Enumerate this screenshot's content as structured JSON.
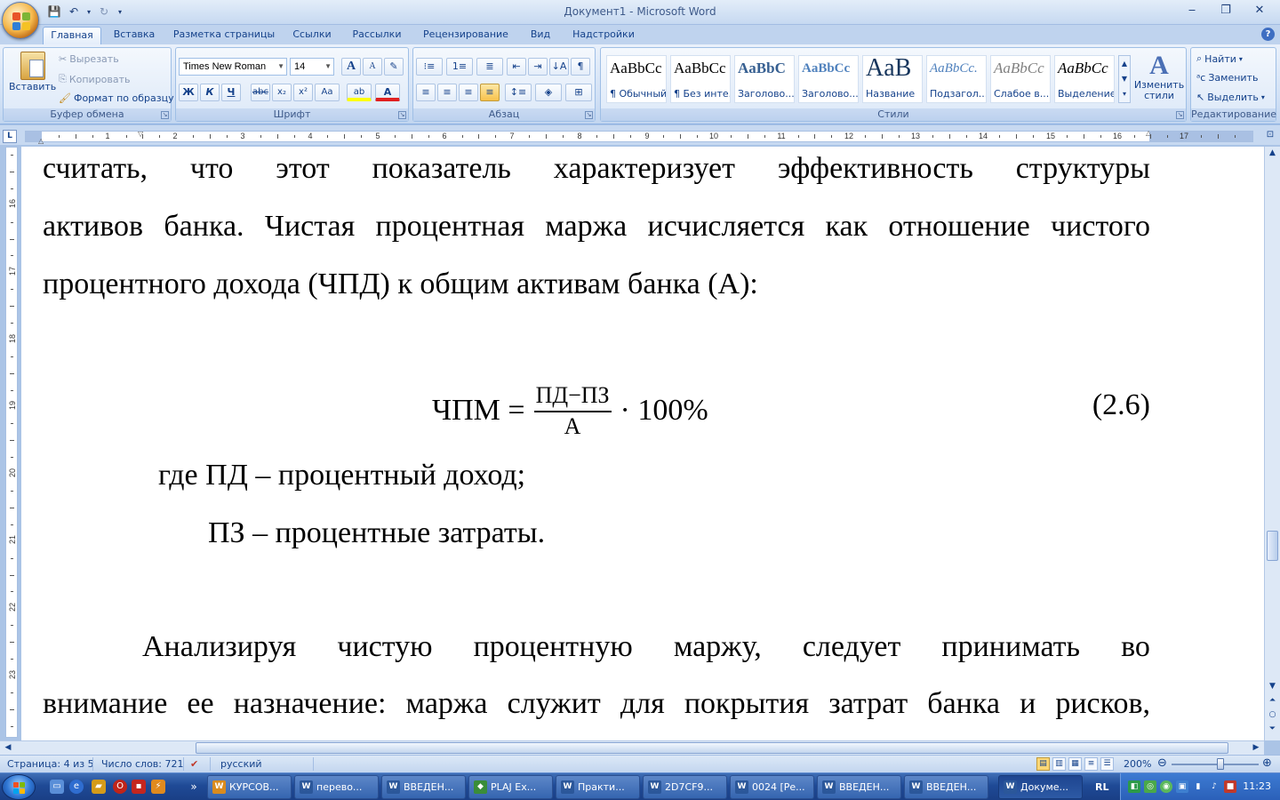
{
  "window": {
    "title": "Документ1 - Microsoft Word",
    "min": "‒",
    "restore": "❐",
    "close": "✕"
  },
  "qat": [
    "💾",
    "↶",
    "▾",
    "↻",
    "▾"
  ],
  "tabs": [
    "Главная",
    "Вставка",
    "Разметка страницы",
    "Ссылки",
    "Рассылки",
    "Рецензирование",
    "Вид",
    "Надстройки"
  ],
  "ribbon": {
    "clipboard": {
      "label": "Буфер обмена",
      "paste": "Вставить",
      "cut": "Вырезать",
      "copy": "Копировать",
      "format_painter": "Формат по образцу"
    },
    "font": {
      "label": "Шрифт",
      "name": "Times New Roman",
      "size": "14",
      "grow": "A",
      "shrink": "A",
      "clear": "✎",
      "bold": "Ж",
      "italic": "К",
      "underline": "Ч",
      "strike": "abc",
      "subscript": "x₂",
      "superscript": "x²",
      "case": "Aa",
      "highlight": "ab",
      "color": "A"
    },
    "paragraph": {
      "label": "Абзац"
    },
    "styles": {
      "label": "Стили",
      "items": [
        {
          "sample": "AaBbCc",
          "name": "¶ Обычный"
        },
        {
          "sample": "AaBbCc",
          "name": "¶ Без инте..."
        },
        {
          "sample": "AaBbC",
          "name": "Заголово..."
        },
        {
          "sample": "AaBbCc",
          "name": "Заголово..."
        },
        {
          "sample": "AaB",
          "name": "Название"
        },
        {
          "sample": "AaBbCc.",
          "name": "Подзагол..."
        },
        {
          "sample": "AaBbCc",
          "name": "Слабое в..."
        },
        {
          "sample": "AaBbCc",
          "name": "Выделение"
        }
      ],
      "change": "Изменить стили"
    },
    "editing": {
      "label": "Редактирование",
      "find": "Найти",
      "replace": "Заменить",
      "select": "Выделить"
    }
  },
  "ruler": {
    "corner": "L",
    "h_numbers": [
      "1",
      "1",
      "2",
      "3",
      "4",
      "5",
      "6",
      "7",
      "8",
      "9",
      "10",
      "11",
      "12",
      "13",
      "14",
      "15",
      "16",
      "17"
    ],
    "v_numbers": [
      "16",
      "17",
      "18",
      "19",
      "20",
      "21",
      "22",
      "23"
    ]
  },
  "document": {
    "line1": [
      "считать,",
      "что",
      "этот",
      "показатель",
      "характеризует",
      "эффективность",
      "структуры"
    ],
    "line2": [
      "активов",
      "банка.",
      "Чистая",
      "процентная",
      "маржа",
      "исчисляется",
      "как",
      "отношение",
      "чистого"
    ],
    "line3": "процентного дохода (ЧПД) к общим активам банка (А):",
    "formula": {
      "lhs": "ЧПМ =",
      "numerator": "ПД−ПЗ",
      "denominator": "А",
      "rhs": "· 100%",
      "number": "(2.6)"
    },
    "where1": "где ПД – процентный доход;",
    "where2": "ПЗ – процентные затраты.",
    "line4": [
      "Анализируя",
      "чистую",
      "процентную",
      "маржу,",
      "следует",
      "принимать",
      "во"
    ],
    "line5": [
      "внимание",
      "ее",
      "назначение:",
      "маржа",
      "служит",
      "для",
      "покрытия",
      "затрат",
      "банка",
      "и",
      "рисков,"
    ]
  },
  "status": {
    "page": "Страница: 4 из 5",
    "words": "Число слов: 721",
    "lang": "русский",
    "zoom": "200%",
    "zoom_level": 0.56
  },
  "taskbar": {
    "items": [
      {
        "label": "КУРСОВ...",
        "icon": "W",
        "color": "#d98b1e"
      },
      {
        "label": "перево...",
        "icon": "W",
        "color": "#2b579a"
      },
      {
        "label": "ВВЕДЕН...",
        "icon": "W",
        "color": "#2b579a"
      },
      {
        "label": "PLAJ Ex...",
        "icon": "◆",
        "color": "#3a8d3a"
      },
      {
        "label": "Практи...",
        "icon": "W",
        "color": "#2b579a"
      },
      {
        "label": "2D7CF9...",
        "icon": "W",
        "color": "#2b579a"
      },
      {
        "label": "0024 [Ре...",
        "icon": "W",
        "color": "#2b579a"
      },
      {
        "label": "ВВЕДЕН...",
        "icon": "W",
        "color": "#2b579a"
      },
      {
        "label": "ВВЕДЕН...",
        "icon": "W",
        "color": "#2b579a"
      },
      {
        "label": "Докуме...",
        "icon": "W",
        "color": "#2b579a"
      }
    ],
    "lang": "RL",
    "clock": "11:23"
  }
}
